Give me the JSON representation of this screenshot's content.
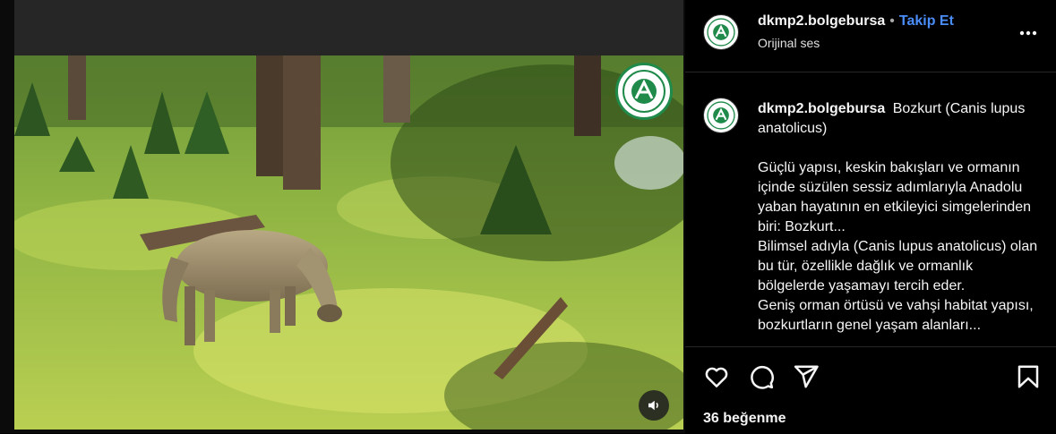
{
  "post": {
    "username": "dkmp2.bolgebursa",
    "follow_label": "Takip Et",
    "separator": "•",
    "audio_label": "Orijinal ses"
  },
  "caption": {
    "username": "dkmp2.bolgebursa",
    "title": "Bozkurt (Canis lupus anatolicus)",
    "lines": [
      "Güçlü yapısı, keskin bakışları ve ormanın içinde süzülen sessiz adımlarıyla Anadolu yaban hayatının en etkileyici simgelerinden biri: Bozkurt...",
      "Bilimsel adıyla (Canis lupus anatolicus) olan bu tür, özellikle dağlık ve ormanlık bölgelerde yaşamayı tercih eder.",
      "Geniş orman örtüsü ve vahşi habitat yapısı, bozkurtların genel yaşam alanları..."
    ]
  },
  "footer": {
    "likes_text": "36 beğenme"
  },
  "icons": {
    "like": "heart-icon",
    "comment": "comment-icon",
    "share": "share-icon",
    "save": "bookmark-icon",
    "more": "more-icon",
    "mute": "speaker-icon"
  },
  "colors": {
    "background": "#000000",
    "link": "#4a8df8",
    "logo_green": "#1f8a4a"
  }
}
